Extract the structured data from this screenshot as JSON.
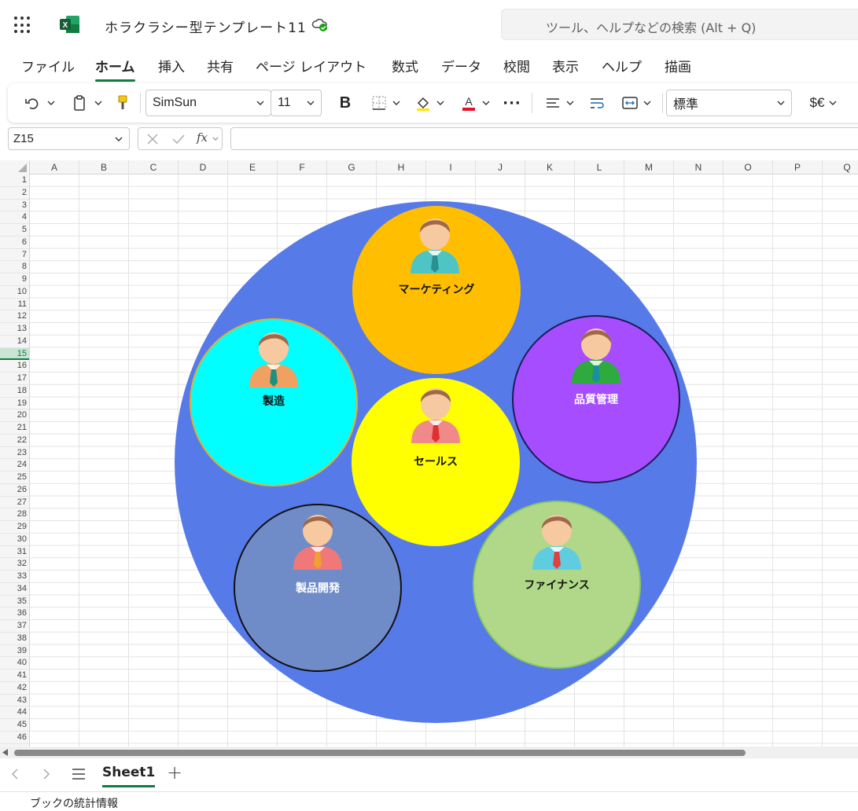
{
  "app": {
    "doc_title": "ホラクラシー型テンプレート11",
    "search_placeholder": "ツール、ヘルプなどの検索 (Alt + Q)"
  },
  "menu": {
    "tabs": [
      "ファイル",
      "ホーム",
      "挿入",
      "共有",
      "ページ レイアウト",
      "数式",
      "データ",
      "校閲",
      "表示",
      "ヘルプ",
      "描画"
    ],
    "active": "ホーム"
  },
  "ribbon": {
    "font_name": "SimSun",
    "font_size": "11",
    "bold_label": "B",
    "number_format": "標準",
    "currency_label": "$€",
    "more_label": "···",
    "font_color": "#e81123",
    "fill_color": "#ffe600"
  },
  "formula_bar": {
    "name_box": "Z15",
    "fx_label": "fx",
    "formula": ""
  },
  "grid": {
    "columns": [
      "A",
      "B",
      "C",
      "D",
      "E",
      "F",
      "G",
      "H",
      "I",
      "J",
      "K",
      "L",
      "M",
      "N",
      "O",
      "P",
      "Q"
    ],
    "rows": [
      "1",
      "2",
      "3",
      "4",
      "5",
      "6",
      "7",
      "8",
      "9",
      "10",
      "11",
      "12",
      "13",
      "14",
      "15",
      "16",
      "17",
      "18",
      "19",
      "20",
      "21",
      "22",
      "23",
      "24",
      "25",
      "26",
      "27",
      "28",
      "29",
      "30",
      "31",
      "32",
      "33",
      "34",
      "35",
      "36",
      "37",
      "38",
      "39",
      "40",
      "41",
      "42",
      "43",
      "44",
      "45",
      "46"
    ],
    "selected_row": "15"
  },
  "diagram": {
    "outer_color": "#567ae8",
    "roles": [
      {
        "label": "マーケティング",
        "fill": "#ffbf00",
        "label_color": "#111111",
        "shirt": "#4fc4c4",
        "tie": "#2a8f8f"
      },
      {
        "label": "製造",
        "fill": "#00ffff",
        "label_color": "#111111",
        "shirt": "#f0a060",
        "tie": "#1f8f7f"
      },
      {
        "label": "品質管理",
        "fill": "#a64dff",
        "label_color": "#ffffff",
        "shirt": "#2eaa3e",
        "tie": "#1a8fa0"
      },
      {
        "label": "セールス",
        "fill": "#ffff00",
        "label_color": "#111111",
        "shirt": "#f08a8a",
        "tie": "#e03030"
      },
      {
        "label": "製品開発",
        "fill": "#708cc8",
        "label_color": "#ffffff",
        "shirt": "#f07878",
        "tie": "#f0a030"
      },
      {
        "label": "ファイナンス",
        "fill": "#b0d888",
        "label_color": "#111111",
        "shirt": "#60cce0",
        "tie": "#e04040"
      }
    ]
  },
  "sheets": {
    "tabs": [
      "Sheet1"
    ],
    "add_label": "+"
  },
  "status": {
    "text": "ブックの統計情報"
  }
}
